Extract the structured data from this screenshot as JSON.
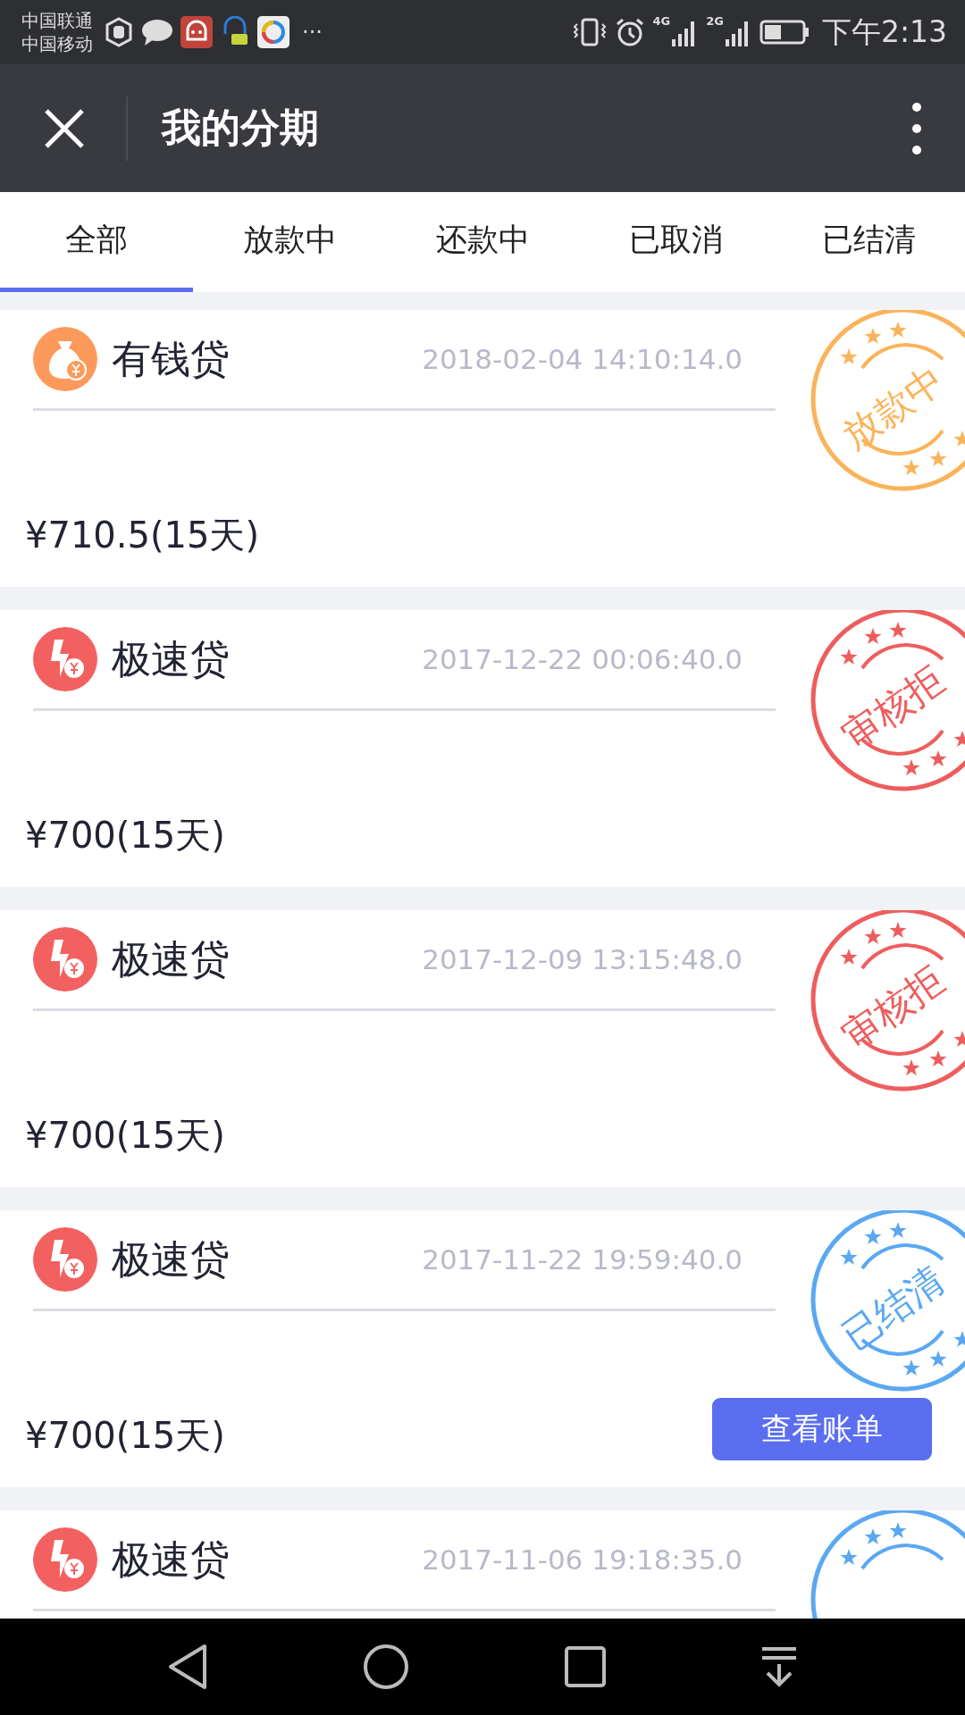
{
  "status_bar": {
    "carriers": [
      "中国联通",
      "中国移动"
    ],
    "more": "···",
    "network_labels": [
      "4G",
      "2G"
    ],
    "time": "下午2:13"
  },
  "header": {
    "title": "我的分期"
  },
  "tabs": [
    {
      "label": "全部",
      "selected": true
    },
    {
      "label": "放款中",
      "selected": false
    },
    {
      "label": "还款中",
      "selected": false
    },
    {
      "label": "已取消",
      "selected": false
    },
    {
      "label": "已结清",
      "selected": false
    }
  ],
  "loans": [
    {
      "kind": "bag",
      "name": "有钱贷",
      "date": "2018-02-04 14:10:14.0",
      "amount": "¥710.5(15天)",
      "stamp": {
        "text": "放款中",
        "color": "#fbb35a"
      }
    },
    {
      "kind": "bolt",
      "name": "极速贷",
      "date": "2017-12-22 00:06:40.0",
      "amount": "¥700(15天)",
      "stamp": {
        "text": "审核拒",
        "color": "#ee5d5d"
      }
    },
    {
      "kind": "bolt",
      "name": "极速贷",
      "date": "2017-12-09 13:15:48.0",
      "amount": "¥700(15天)",
      "stamp": {
        "text": "审核拒",
        "color": "#ee5d5d"
      }
    },
    {
      "kind": "bolt",
      "name": "极速贷",
      "date": "2017-11-22 19:59:40.0",
      "amount": "¥700(15天)",
      "stamp": {
        "text": "已结清",
        "color": "#5aa8f2"
      },
      "button": "查看账单"
    },
    {
      "kind": "bolt",
      "name": "极速贷",
      "date": "2017-11-06 19:18:35.0",
      "stamp": {
        "color": "#5aa8f2"
      }
    }
  ]
}
